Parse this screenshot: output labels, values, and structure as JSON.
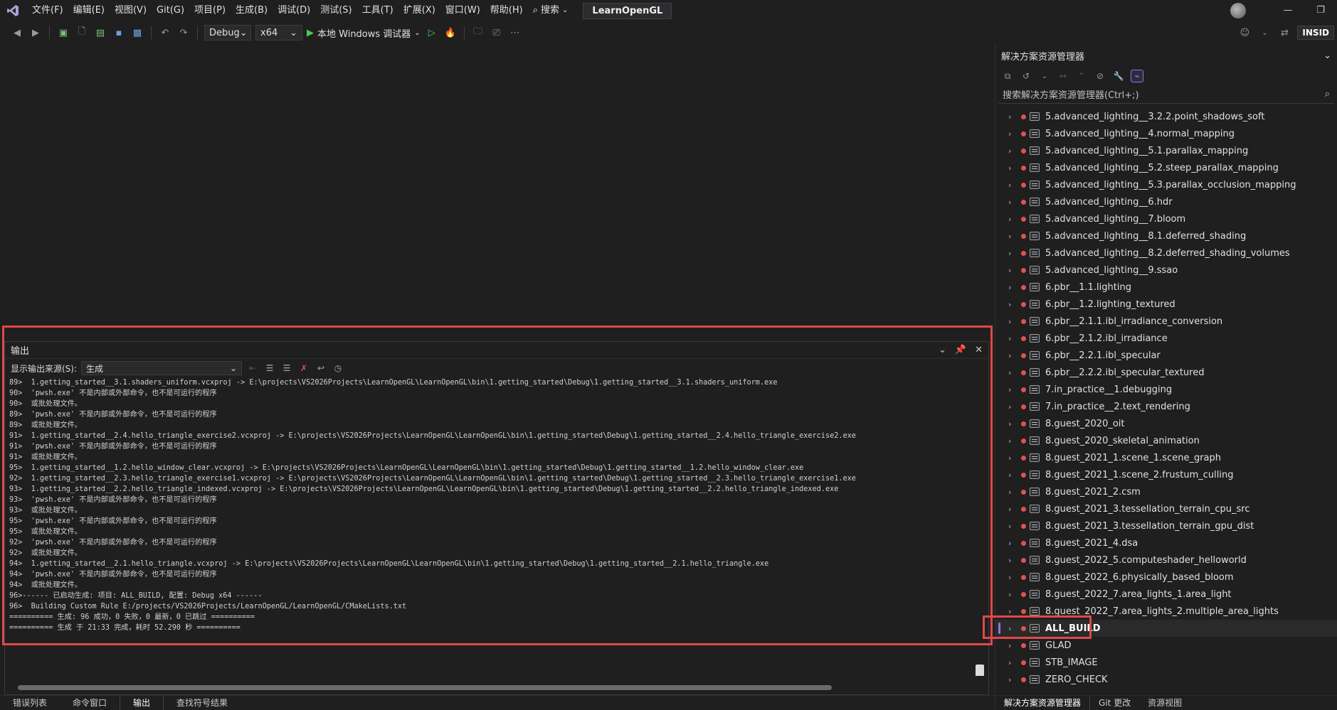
{
  "menu": [
    "文件(F)",
    "编辑(E)",
    "视图(V)",
    "Git(G)",
    "项目(P)",
    "生成(B)",
    "调试(D)",
    "测试(S)",
    "工具(T)",
    "扩展(X)",
    "窗口(W)",
    "帮助(H)"
  ],
  "search_label": "搜索",
  "solution_name": "LearnOpenGL",
  "toolbar": {
    "config": "Debug",
    "platform": "x64",
    "run_label": "本地 Windows 调试器"
  },
  "inside_badge": "INSID",
  "output": {
    "title": "输出",
    "source_label": "显示输出来源(S):",
    "source_value": "生成",
    "lines": [
      "89>  1.getting_started__3.1.shaders_uniform.vcxproj -> E:\\projects\\VS2026Projects\\LearnOpenGL\\LearnOpenGL\\bin\\1.getting_started\\Debug\\1.getting_started__3.1.shaders_uniform.exe",
      "90>  'pwsh.exe' 不是内部或外部命令，也不是可运行的程序",
      "90>  或批处理文件。",
      "89>  'pwsh.exe' 不是内部或外部命令，也不是可运行的程序",
      "89>  或批处理文件。",
      "91>  1.getting_started__2.4.hello_triangle_exercise2.vcxproj -> E:\\projects\\VS2026Projects\\LearnOpenGL\\LearnOpenGL\\bin\\1.getting_started\\Debug\\1.getting_started__2.4.hello_triangle_exercise2.exe",
      "91>  'pwsh.exe' 不是内部或外部命令，也不是可运行的程序",
      "91>  或批处理文件。",
      "95>  1.getting_started__1.2.hello_window_clear.vcxproj -> E:\\projects\\VS2026Projects\\LearnOpenGL\\LearnOpenGL\\bin\\1.getting_started\\Debug\\1.getting_started__1.2.hello_window_clear.exe",
      "92>  1.getting_started__2.3.hello_triangle_exercise1.vcxproj -> E:\\projects\\VS2026Projects\\LearnOpenGL\\LearnOpenGL\\bin\\1.getting_started\\Debug\\1.getting_started__2.3.hello_triangle_exercise1.exe",
      "93>  1.getting_started__2.2.hello_triangle_indexed.vcxproj -> E:\\projects\\VS2026Projects\\LearnOpenGL\\LearnOpenGL\\bin\\1.getting_started\\Debug\\1.getting_started__2.2.hello_triangle_indexed.exe",
      "93>  'pwsh.exe' 不是内部或外部命令，也不是可运行的程序",
      "93>  或批处理文件。",
      "95>  'pwsh.exe' 不是内部或外部命令，也不是可运行的程序",
      "95>  或批处理文件。",
      "92>  'pwsh.exe' 不是内部或外部命令，也不是可运行的程序",
      "92>  或批处理文件。",
      "94>  1.getting_started__2.1.hello_triangle.vcxproj -> E:\\projects\\VS2026Projects\\LearnOpenGL\\LearnOpenGL\\bin\\1.getting_started\\Debug\\1.getting_started__2.1.hello_triangle.exe",
      "94>  'pwsh.exe' 不是内部或外部命令，也不是可运行的程序",
      "94>  或批处理文件。",
      "96>------ 已启动生成: 项目: ALL_BUILD, 配置: Debug x64 ------",
      "96>  Building Custom Rule E:/projects/VS2026Projects/LearnOpenGL/LearnOpenGL/CMakeLists.txt",
      "========== 生成: 96 成功，0 失败，0 最新，0 已跳过 ==========",
      "========== 生成 于 21:33 完成，耗时 52.290 秒 =========="
    ]
  },
  "bottom_tabs": [
    "错误列表",
    "命令窗口",
    "输出",
    "查找符号结果"
  ],
  "solution_explorer": {
    "title": "解决方案资源管理器",
    "search_placeholder": "搜索解决方案资源管理器(Ctrl+;)",
    "items": [
      "5.advanced_lighting__3.2.2.point_shadows_soft",
      "5.advanced_lighting__4.normal_mapping",
      "5.advanced_lighting__5.1.parallax_mapping",
      "5.advanced_lighting__5.2.steep_parallax_mapping",
      "5.advanced_lighting__5.3.parallax_occlusion_mapping",
      "5.advanced_lighting__6.hdr",
      "5.advanced_lighting__7.bloom",
      "5.advanced_lighting__8.1.deferred_shading",
      "5.advanced_lighting__8.2.deferred_shading_volumes",
      "5.advanced_lighting__9.ssao",
      "6.pbr__1.1.lighting",
      "6.pbr__1.2.lighting_textured",
      "6.pbr__2.1.1.ibl_irradiance_conversion",
      "6.pbr__2.1.2.ibl_irradiance",
      "6.pbr__2.2.1.ibl_specular",
      "6.pbr__2.2.2.ibl_specular_textured",
      "7.in_practice__1.debugging",
      "7.in_practice__2.text_rendering",
      "8.guest_2020_oit",
      "8.guest_2020_skeletal_animation",
      "8.guest_2021_1.scene_1.scene_graph",
      "8.guest_2021_1.scene_2.frustum_culling",
      "8.guest_2021_2.csm",
      "8.guest_2021_3.tessellation_terrain_cpu_src",
      "8.guest_2021_3.tessellation_terrain_gpu_dist",
      "8.guest_2021_4.dsa",
      "8.guest_2022_5.computeshader_helloworld",
      "8.guest_2022_6.physically_based_bloom",
      "8.guest_2022_7.area_lights_1.area_light",
      "8.guest_2022_7.area_lights_2.multiple_area_lights",
      "ALL_BUILD",
      "GLAD",
      "STB_IMAGE",
      "ZERO_CHECK"
    ],
    "selected_item": "ALL_BUILD",
    "tabs": [
      "解决方案资源管理器",
      "Git 更改",
      "资源视图"
    ]
  },
  "colors": {
    "highlight_box": "#e04848",
    "accent": "#8a7ad6",
    "error_dot": "#e05252"
  }
}
